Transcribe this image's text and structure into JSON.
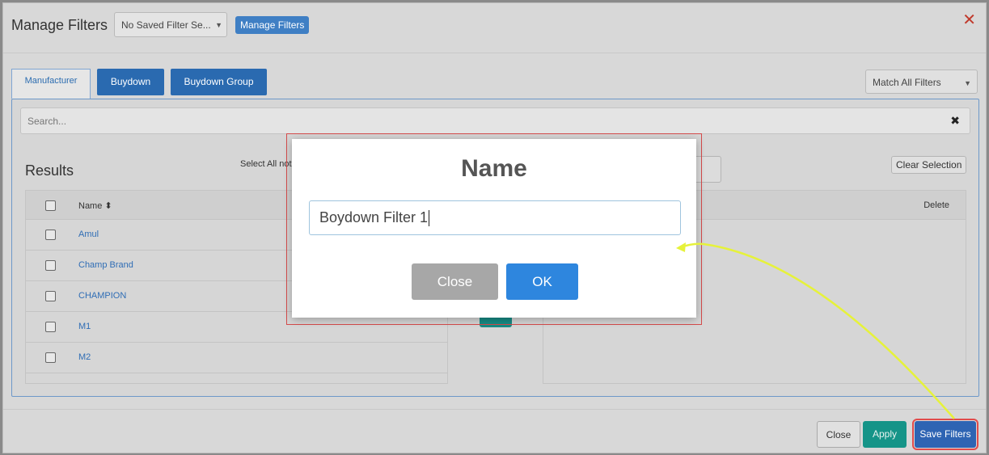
{
  "header": {
    "title": "Manage Filters",
    "saved_filter_value": "No Saved Filter Se...",
    "manage_filters_label": "Manage Filters",
    "close_glyph": "✕"
  },
  "tabs": [
    {
      "label": "Manufacturer"
    },
    {
      "label": "Buydown"
    },
    {
      "label": "Buydown Group"
    }
  ],
  "match_select": {
    "value": "Match All Filters"
  },
  "search": {
    "placeholder": "Search...",
    "clear_glyph": "✖"
  },
  "results": {
    "title": "Results",
    "select_all_label": "Select All not",
    "clear_selection_label": "Clear Selection",
    "name_header": "Name ⬍",
    "delete_header": "Delete",
    "rows": [
      "Amul",
      "Champ Brand",
      "CHAMPION",
      "M1",
      "M2"
    ]
  },
  "footer": {
    "close_label": "Close",
    "apply_label": "Apply",
    "save_label": "Save Filters"
  },
  "modal": {
    "title": "Name",
    "input_value": "Boydown Filter 1",
    "close_label": "Close",
    "ok_label": "OK"
  },
  "colors": {
    "primary": "#2e86de",
    "header_blue": "#2a6ab0",
    "teal": "#159488",
    "annotation_red": "#d54b4b",
    "annotation_arrow": "#e6f23a"
  }
}
